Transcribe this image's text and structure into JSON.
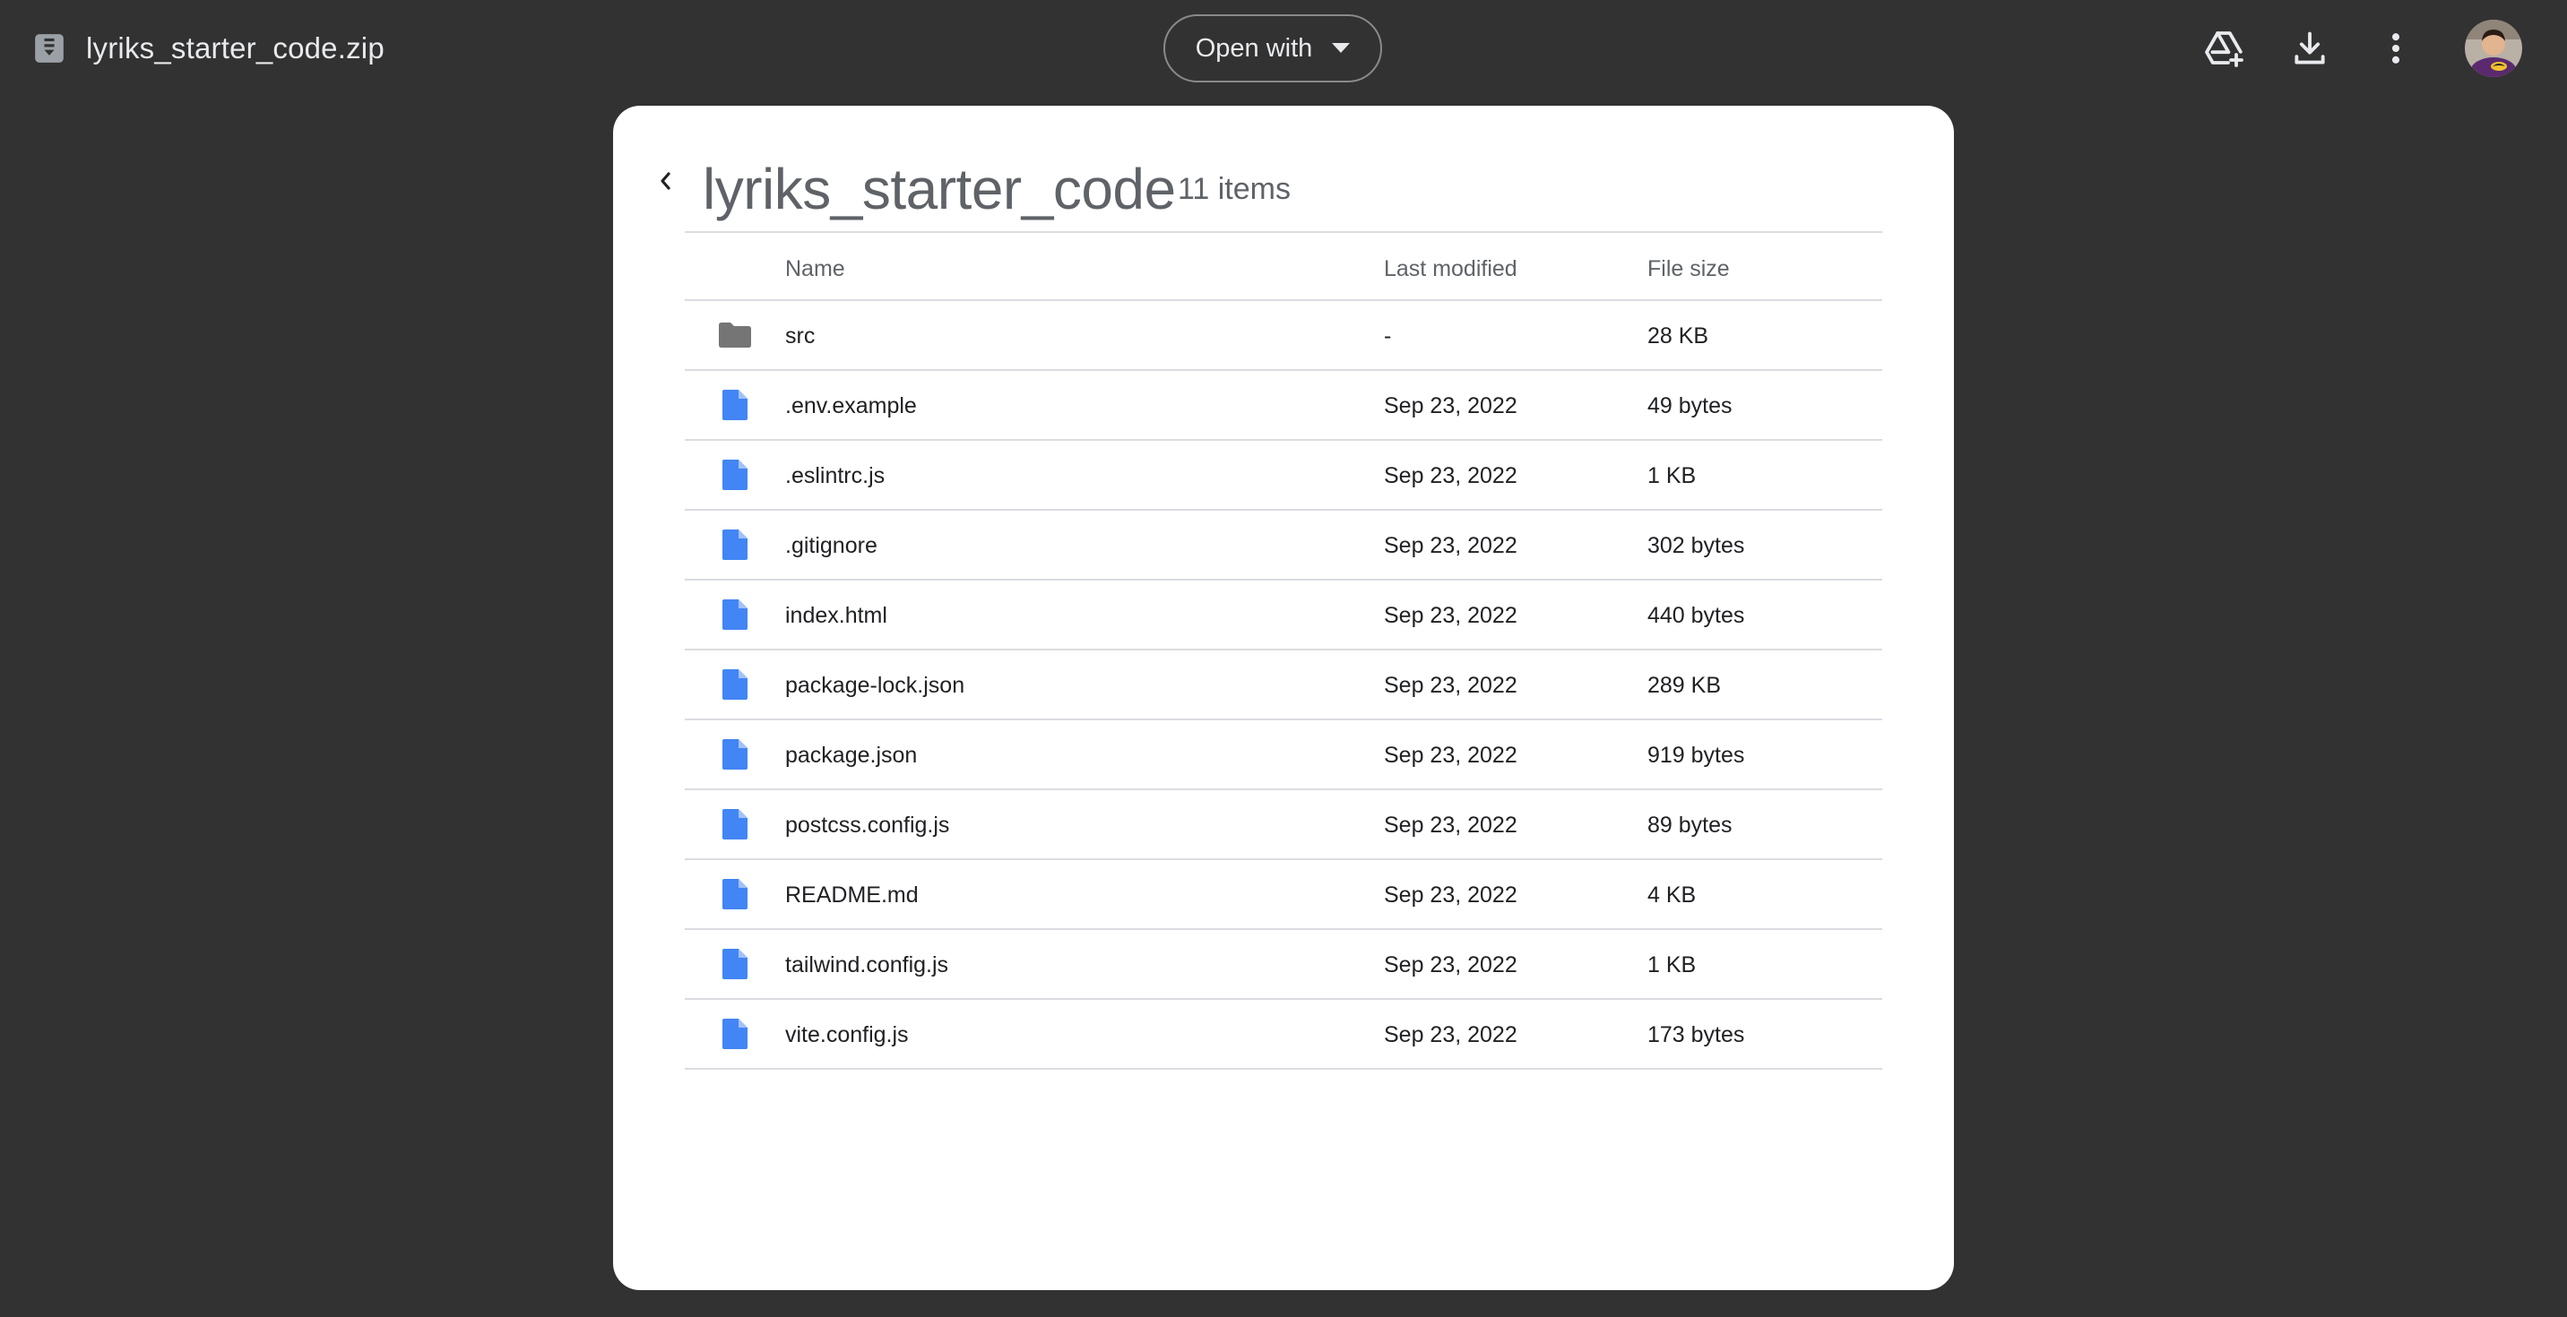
{
  "header": {
    "file_name": "lyriks_starter_code.zip",
    "open_with_label": "Open with"
  },
  "colors": {
    "background": "#323232",
    "file_icon": "#4285f4",
    "folder_icon": "#757575"
  },
  "folder": {
    "title": "lyriks_starter_code",
    "item_count": "11 items"
  },
  "table": {
    "columns": {
      "name": "Name",
      "modified": "Last modified",
      "size": "File size"
    },
    "rows": [
      {
        "icon": "folder-icon",
        "name": "src",
        "modified": "-",
        "size": "28 KB"
      },
      {
        "icon": "file-icon",
        "name": ".env.example",
        "modified": "Sep 23, 2022",
        "size": "49 bytes"
      },
      {
        "icon": "file-icon",
        "name": ".eslintrc.js",
        "modified": "Sep 23, 2022",
        "size": "1 KB"
      },
      {
        "icon": "file-icon",
        "name": ".gitignore",
        "modified": "Sep 23, 2022",
        "size": "302 bytes"
      },
      {
        "icon": "file-icon",
        "name": "index.html",
        "modified": "Sep 23, 2022",
        "size": "440 bytes"
      },
      {
        "icon": "file-icon",
        "name": "package-lock.json",
        "modified": "Sep 23, 2022",
        "size": "289 KB"
      },
      {
        "icon": "file-icon",
        "name": "package.json",
        "modified": "Sep 23, 2022",
        "size": "919 bytes"
      },
      {
        "icon": "file-icon",
        "name": "postcss.config.js",
        "modified": "Sep 23, 2022",
        "size": "89 bytes"
      },
      {
        "icon": "file-icon",
        "name": "README.md",
        "modified": "Sep 23, 2022",
        "size": "4 KB"
      },
      {
        "icon": "file-icon",
        "name": "tailwind.config.js",
        "modified": "Sep 23, 2022",
        "size": "1 KB"
      },
      {
        "icon": "file-icon",
        "name": "vite.config.js",
        "modified": "Sep 23, 2022",
        "size": "173 bytes"
      }
    ]
  }
}
